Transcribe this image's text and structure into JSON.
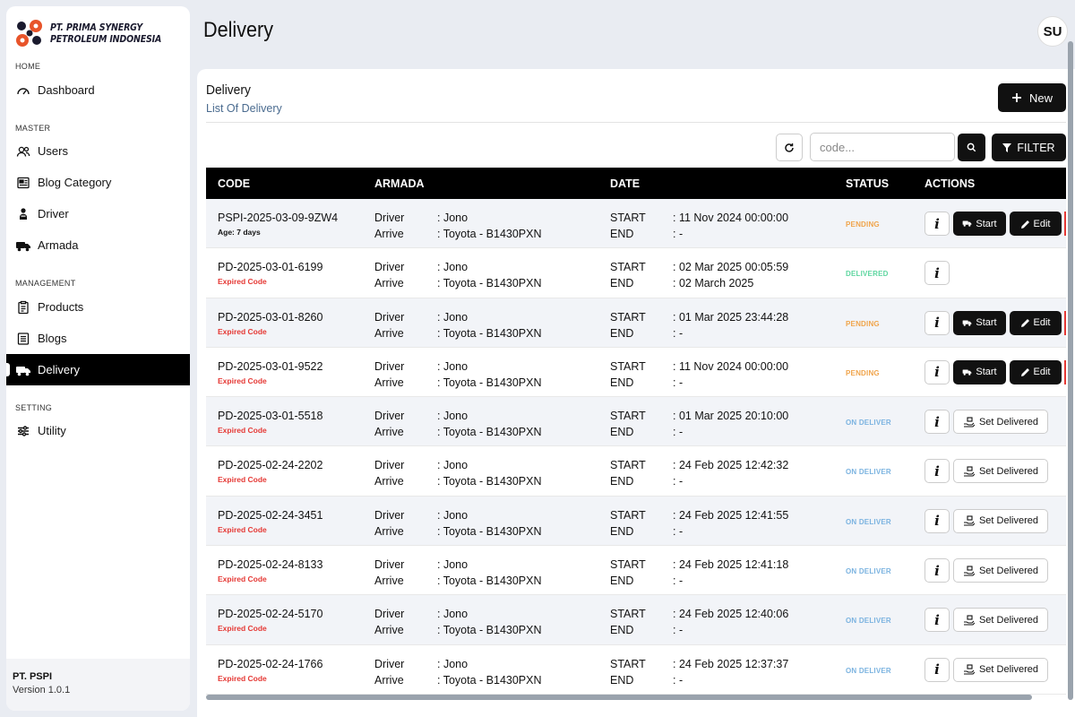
{
  "sidebar": {
    "brand_line1": "PT. PRIMA SYNERGY",
    "brand_line2": "PETROLEUM INDONESIA",
    "sections": {
      "home": "HOME",
      "master": "MASTER",
      "management": "MANAGEMENT",
      "setting": "SETTING"
    },
    "items": {
      "dashboard": "Dashboard",
      "users": "Users",
      "blog_category": "Blog Category",
      "driver": "Driver",
      "armada": "Armada",
      "products": "Products",
      "blogs": "Blogs",
      "delivery": "Delivery",
      "utility": "Utility"
    },
    "footer_company": "PT. PSPI",
    "footer_version": "Version 1.0.1"
  },
  "header": {
    "title": "Delivery",
    "avatar_initials": "SU"
  },
  "card": {
    "title": "Delivery",
    "subtitle": "List Of Delivery",
    "new_label": "New",
    "search_placeholder": "code...",
    "filter_label": "FILTER"
  },
  "table": {
    "headers": {
      "code": "CODE",
      "armada": "ARMADA",
      "date": "DATE",
      "status": "STATUS",
      "actions": "ACTIONS"
    },
    "labels": {
      "driver": "Driver",
      "arrive": "Arrive",
      "start": "START",
      "end": "END"
    },
    "action_labels": {
      "info": "i",
      "start": "Start",
      "edit": "Edit",
      "set_delivered": "Set Delivered"
    },
    "rows": [
      {
        "code": "PSPI-2025-03-09-9ZW4",
        "sub": "Age: 7 days",
        "sub_type": "age",
        "driver": ": Jono",
        "arrive": ": Toyota - B1430PXN",
        "start": ": 11 Nov 2024 00:00:00",
        "end": ": -",
        "status": "PENDING",
        "status_color": "#f0a44b",
        "actions": "start_edit"
      },
      {
        "code": "PD-2025-03-01-6199",
        "sub": "Expired Code",
        "sub_type": "expired",
        "driver": ": Jono",
        "arrive": ": Toyota - B1430PXN",
        "start": ": 02 Mar 2025 00:05:59",
        "end": ": 02 March 2025",
        "status": "DELIVERED",
        "status_color": "#5ed6a0",
        "actions": "info_only"
      },
      {
        "code": "PD-2025-03-01-8260",
        "sub": "Expired Code",
        "sub_type": "expired",
        "driver": ": Jono",
        "arrive": ": Toyota - B1430PXN",
        "start": ": 01 Mar 2025 23:44:28",
        "end": ": -",
        "status": "PENDING",
        "status_color": "#f0a44b",
        "actions": "start_edit"
      },
      {
        "code": "PD-2025-03-01-9522",
        "sub": "Expired Code",
        "sub_type": "expired",
        "driver": ": Jono",
        "arrive": ": Toyota - B1430PXN",
        "start": ": 11 Nov 2024 00:00:00",
        "end": ": -",
        "status": "PENDING",
        "status_color": "#f0a44b",
        "actions": "start_edit"
      },
      {
        "code": "PD-2025-03-01-5518",
        "sub": "Expired Code",
        "sub_type": "expired",
        "driver": ": Jono",
        "arrive": ": Toyota - B1430PXN",
        "start": ": 01 Mar 2025 20:10:00",
        "end": ": -",
        "status": "ON DELIVER",
        "status_color": "#7bb3e0",
        "actions": "set_delivered"
      },
      {
        "code": "PD-2025-02-24-2202",
        "sub": "Expired Code",
        "sub_type": "expired",
        "driver": ": Jono",
        "arrive": ": Toyota - B1430PXN",
        "start": ": 24 Feb 2025 12:42:32",
        "end": ": -",
        "status": "ON DELIVER",
        "status_color": "#7bb3e0",
        "actions": "set_delivered"
      },
      {
        "code": "PD-2025-02-24-3451",
        "sub": "Expired Code",
        "sub_type": "expired",
        "driver": ": Jono",
        "arrive": ": Toyota - B1430PXN",
        "start": ": 24 Feb 2025 12:41:55",
        "end": ": -",
        "status": "ON DELIVER",
        "status_color": "#7bb3e0",
        "actions": "set_delivered"
      },
      {
        "code": "PD-2025-02-24-8133",
        "sub": "Expired Code",
        "sub_type": "expired",
        "driver": ": Jono",
        "arrive": ": Toyota - B1430PXN",
        "start": ": 24 Feb 2025 12:41:18",
        "end": ": -",
        "status": "ON DELIVER",
        "status_color": "#7bb3e0",
        "actions": "set_delivered"
      },
      {
        "code": "PD-2025-02-24-5170",
        "sub": "Expired Code",
        "sub_type": "expired",
        "driver": ": Jono",
        "arrive": ": Toyota - B1430PXN",
        "start": ": 24 Feb 2025 12:40:06",
        "end": ": -",
        "status": "ON DELIVER",
        "status_color": "#7bb3e0",
        "actions": "set_delivered"
      },
      {
        "code": "PD-2025-02-24-1766",
        "sub": "Expired Code",
        "sub_type": "expired",
        "driver": ": Jono",
        "arrive": ": Toyota - B1430PXN",
        "start": ": 24 Feb 2025 12:37:37",
        "end": ": -",
        "status": "ON DELIVER",
        "status_color": "#7bb3e0",
        "actions": "set_delivered"
      }
    ]
  },
  "colors": {
    "accent": "#111111",
    "expired": "#e53935",
    "pending": "#f0a44b",
    "delivered": "#5ed6a0",
    "on_deliver": "#7bb3e0",
    "logo_orange": "#e8542a",
    "logo_dark": "#1a1a2e"
  },
  "icons": {
    "logo": "company-logo",
    "dashboard": "gauge-icon",
    "users": "users-icon",
    "blog_category": "newspaper-icon",
    "driver": "driver-icon",
    "armada": "truck-icon",
    "products": "clipboard-list-icon",
    "blogs": "document-icon",
    "delivery": "delivery-truck-icon",
    "utility": "sliders-icon"
  }
}
